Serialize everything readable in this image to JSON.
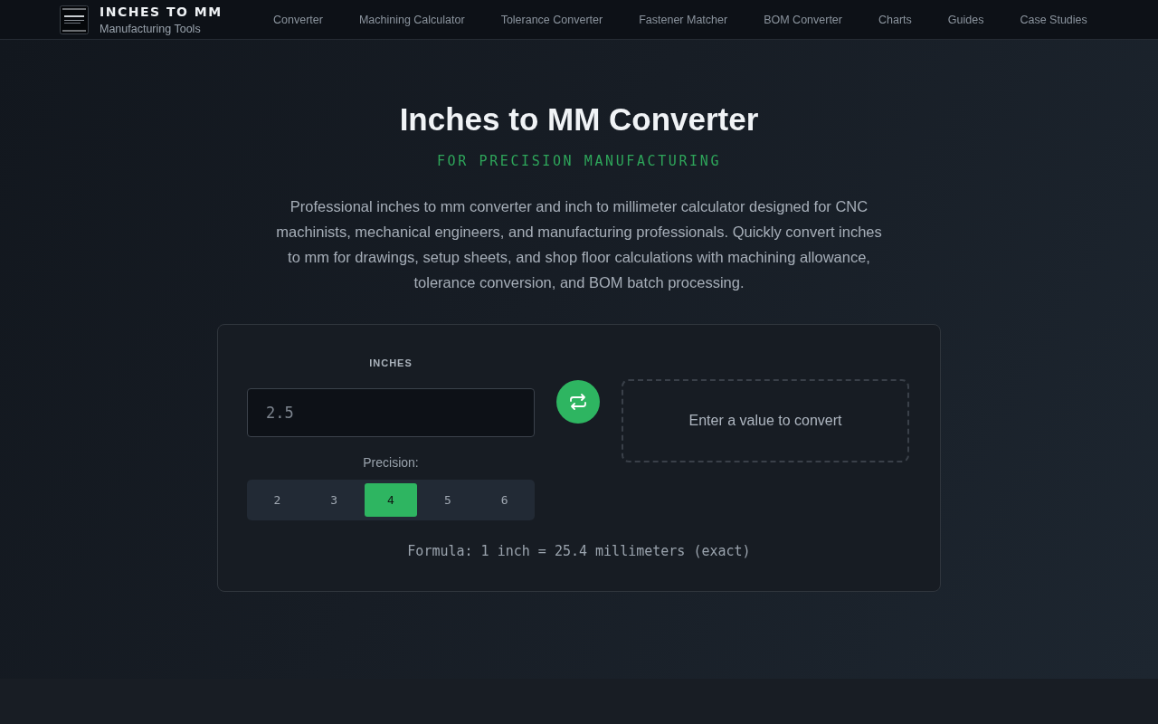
{
  "header": {
    "brand": {
      "title": "INCHES TO MM",
      "subtitle": "Manufacturing Tools"
    },
    "nav": [
      {
        "label": "Converter"
      },
      {
        "label": "Machining Calculator"
      },
      {
        "label": "Tolerance Converter"
      },
      {
        "label": "Fastener Matcher"
      },
      {
        "label": "BOM Converter"
      },
      {
        "label": "Charts"
      },
      {
        "label": "Guides"
      },
      {
        "label": "Case Studies"
      }
    ]
  },
  "hero": {
    "title": "Inches to MM Converter",
    "subtitle": "FOR PRECISION MANUFACTURING",
    "description": "Professional inches to mm converter and inch to millimeter calculator designed for CNC machinists, mechanical engineers, and manufacturing professionals. Quickly convert inches to mm for drawings, setup sheets, and shop floor calculations with machining allowance, tolerance conversion, and BOM batch processing."
  },
  "converter": {
    "input": {
      "label": "INCHES",
      "placeholder": "2.5"
    },
    "precision": {
      "label": "Precision:",
      "options": [
        {
          "label": "2",
          "selected": false
        },
        {
          "label": "3",
          "selected": false
        },
        {
          "label": "4",
          "selected": true
        },
        {
          "label": "5",
          "selected": false
        },
        {
          "label": "6",
          "selected": false
        }
      ]
    },
    "result": {
      "text": "Enter a value to convert"
    },
    "formula": "Formula: 1 inch = 25.4 millimeters (exact)"
  }
}
